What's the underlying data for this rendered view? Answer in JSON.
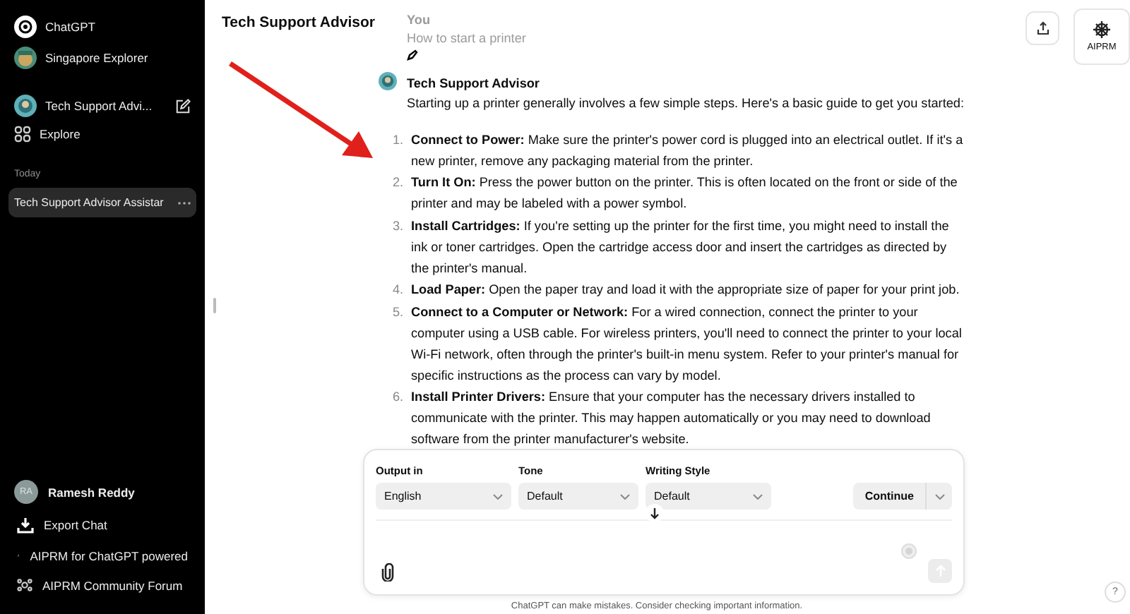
{
  "sidebar": {
    "items": [
      {
        "kind": "logo",
        "label": "ChatGPT"
      },
      {
        "kind": "gpt",
        "label": "Singapore Explorer"
      },
      {
        "kind": "gpt-current",
        "label": "Tech Support Advi..."
      },
      {
        "kind": "explore",
        "label": "Explore"
      }
    ],
    "history": {
      "heading": "Today",
      "chats": [
        {
          "title": "Tech Support Advisor Assistar",
          "selected": true
        }
      ]
    },
    "user": {
      "initials": "RA",
      "name": "Ramesh Reddy"
    },
    "links": [
      {
        "kind": "export",
        "label": "Export Chat"
      },
      {
        "kind": "plugin",
        "label": "AIPRM for ChatGPT powered"
      },
      {
        "kind": "community",
        "label": "AIPRM Community Forum"
      }
    ]
  },
  "header": {
    "title": "Tech Support Advisor",
    "badge": "AIPRM"
  },
  "previous_message": {
    "author": "You",
    "text": "How to start a printer"
  },
  "message": {
    "author": "Tech Support Advisor",
    "intro": "Starting up a printer generally involves a few simple steps. Here's a basic guide to get you started:",
    "steps": [
      {
        "number": "1.",
        "text": "**Connect to Power:** Make sure the printer's power cord is plugged into an electrical outlet. If it's a new printer, remove any packaging material from the printer."
      },
      {
        "number": "2.",
        "text": "**Turn It On:** Press the power button on the printer. This is often located on the front or side of the printer and may be labeled with a power symbol."
      },
      {
        "number": "3.",
        "text": "**Install Cartridges:** If you're setting up the printer for the first time, you might need to install the ink or toner cartridges. Open the cartridge access door and insert the cartridges as directed by the printer's manual."
      },
      {
        "number": "4.",
        "text": "**Load Paper:** Open the paper tray and load it with the appropriate size of paper for your print job."
      },
      {
        "number": "5.",
        "text": "**Connect to a Computer or Network:** For a wired connection, connect the printer to your computer using a USB cable. For wireless printers, you'll need to connect the printer to your local Wi-Fi network, often through the printer's built-in menu system. Refer to your printer's manual for specific instructions as the process can vary by model."
      },
      {
        "number": "6.",
        "text": "**Install Printer Drivers:** Ensure that your computer has the necessary drivers installed to communicate with the printer. This may happen automatically or you may need to download software from the printer manufacturer's website."
      }
    ]
  },
  "composer": {
    "fields": [
      {
        "label": "Output in",
        "value": "English"
      },
      {
        "label": "Tone",
        "value": "Default"
      },
      {
        "label": "Writing Style",
        "value": "Default"
      }
    ],
    "primary": "Continue",
    "send_disabled": true
  },
  "disclaimer": "ChatGPT can make mistakes. Consider checking important information.",
  "help": "?"
}
